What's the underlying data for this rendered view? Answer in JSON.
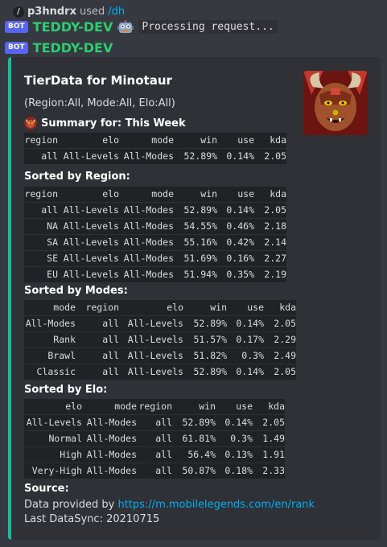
{
  "header": {
    "slash_glyph": "/",
    "user": "p3hndrx",
    "used": "used",
    "command": "/dh"
  },
  "bot_message_1": {
    "tag": "BOT",
    "name": "TEDDY-DEV",
    "status": "Processing request..."
  },
  "bot_message_2": {
    "tag": "BOT",
    "name": "TEDDY-DEV"
  },
  "embed": {
    "accent_color": "#1abc9c",
    "title": "TierData for Minotaur",
    "subtitle": "(Region:All, Mode:All, Elo:All)",
    "summary": {
      "title": "Summary for: This Week",
      "header": [
        "region",
        "elo",
        "mode",
        "win",
        "use",
        "kda"
      ],
      "rows": [
        [
          "all",
          "All-Levels",
          "All-Modes",
          "52.89%",
          "0.14%",
          "2.05"
        ]
      ]
    },
    "by_region": {
      "title": "Sorted by Region:",
      "header": [
        "region",
        "elo",
        "mode",
        "win",
        "use",
        "kda"
      ],
      "rows": [
        [
          "all",
          "All-Levels",
          "All-Modes",
          "52.89%",
          "0.14%",
          "2.05"
        ],
        [
          "NA",
          "All-Levels",
          "All-Modes",
          "54.55%",
          "0.46%",
          "2.18"
        ],
        [
          "SA",
          "All-Levels",
          "All-Modes",
          "55.16%",
          "0.42%",
          "2.14"
        ],
        [
          "SE",
          "All-Levels",
          "All-Modes",
          "51.69%",
          "0.16%",
          "2.27"
        ],
        [
          "EU",
          "All-Levels",
          "All-Modes",
          "51.94%",
          "0.35%",
          "2.19"
        ]
      ]
    },
    "by_mode": {
      "title": "Sorted by Modes:",
      "header": [
        "mode",
        "region",
        "elo",
        "win",
        "use",
        "kda"
      ],
      "rows": [
        [
          "All-Modes",
          "all",
          "All-Levels",
          "52.89%",
          "0.14%",
          "2.05"
        ],
        [
          "Rank",
          "all",
          "All-Levels",
          "51.57%",
          "0.17%",
          "2.29"
        ],
        [
          "Brawl",
          "all",
          "All-Levels",
          "51.82%",
          "0.3%",
          "2.49"
        ],
        [
          "Classic",
          "all",
          "All-Levels",
          "52.89%",
          "0.14%",
          "2.05"
        ]
      ]
    },
    "by_elo": {
      "title": "Sorted by Elo:",
      "header": [
        "elo",
        "mode",
        "region",
        "win",
        "use",
        "kda"
      ],
      "rows": [
        [
          "All-Levels",
          "All-Modes",
          "all",
          "52.89%",
          "0.14%",
          "2.05"
        ],
        [
          "Normal",
          "All-Modes",
          "all",
          "61.81%",
          "0.3%",
          "1.49"
        ],
        [
          "High",
          "All-Modes",
          "all",
          "56.4%",
          "0.13%",
          "1.91"
        ],
        [
          "Very-High",
          "All-Modes",
          "all",
          "50.87%",
          "0.18%",
          "2.33"
        ]
      ]
    },
    "source": {
      "title": "Source:",
      "provided_prefix": "Data provided by",
      "link_text": "https://m.mobilelegends.com/en/rank",
      "sync_label": "Last DataSync: 20210715"
    }
  }
}
